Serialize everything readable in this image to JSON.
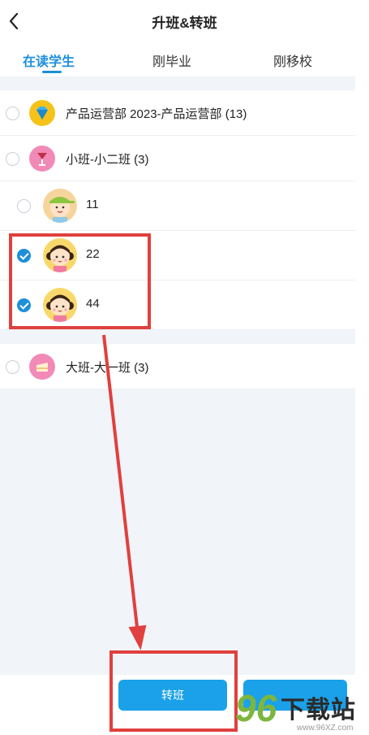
{
  "header": {
    "title": "升班&转班",
    "back_icon": "chevron-left-icon"
  },
  "tabs": [
    {
      "label": "在读学生",
      "active": true
    },
    {
      "label": "刚毕业",
      "active": false
    },
    {
      "label": "刚移校",
      "active": false
    }
  ],
  "groups": [
    {
      "label": "产品运营部 2023-产品运营部 (13)",
      "icon": "diamond-icon",
      "checked": false
    },
    {
      "label": "小班-小二班 (3)",
      "icon": "cocktail-icon",
      "checked": false
    }
  ],
  "students": [
    {
      "label": "11",
      "avatar": "boy-avatar",
      "checked": false
    },
    {
      "label": "22",
      "avatar": "girl-avatar",
      "checked": true
    },
    {
      "label": "44",
      "avatar": "girl-avatar",
      "checked": true
    }
  ],
  "group3": {
    "label": "大班-大一班 (3)",
    "icon": "cake-icon",
    "checked": false
  },
  "footer": {
    "transfer_label": "转班"
  },
  "watermark": {
    "brand": "96",
    "name": "下载站",
    "url": "www.96XZ.com"
  },
  "colors": {
    "accent": "#1e8fd9",
    "button": "#1aa1ea",
    "annotation": "#e0403e"
  }
}
